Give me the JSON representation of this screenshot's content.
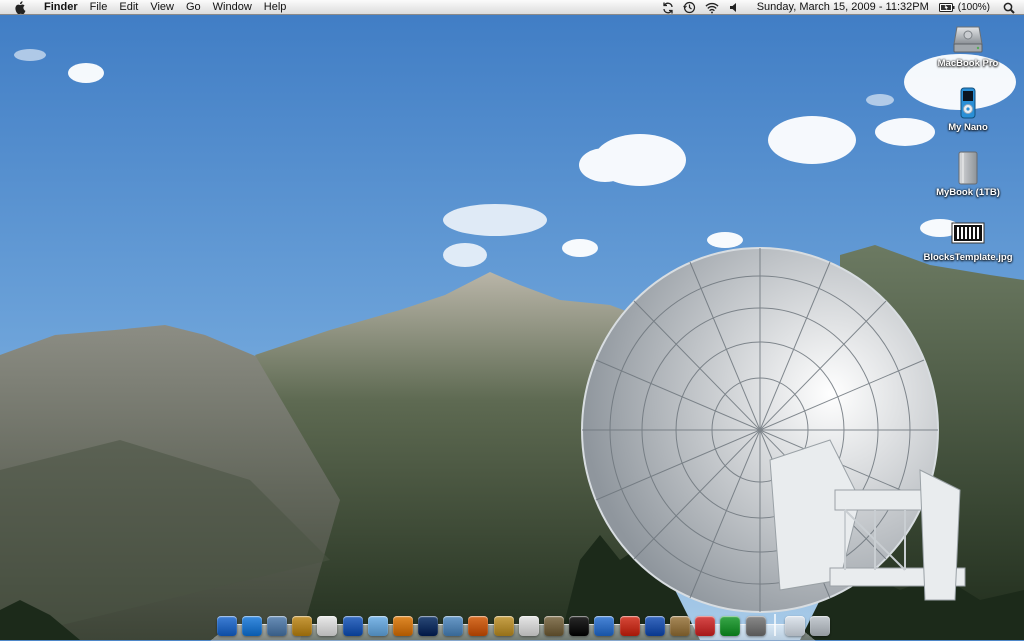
{
  "menubar": {
    "app_name": "Finder",
    "menus": [
      "File",
      "Edit",
      "View",
      "Go",
      "Window",
      "Help"
    ],
    "clock": "Sunday, March 15, 2009 - 11:32PM",
    "battery": "(100%)"
  },
  "desktop_icons": [
    {
      "label": "MacBook Pro",
      "icon": "hard-drive-icon"
    },
    {
      "label": "My Nano",
      "icon": "ipod-nano-icon"
    },
    {
      "label": "MyBook (1TB)",
      "icon": "external-drive-icon"
    },
    {
      "label": "BlocksTemplate.jpg",
      "icon": "image-file-icon"
    }
  ],
  "dock": {
    "apps": [
      {
        "icon": "finder-icon",
        "color": "#3f7fd6"
      },
      {
        "icon": "safari-icon",
        "color": "#3b8de0"
      },
      {
        "icon": "mail-icon",
        "color": "#6a8fb8"
      },
      {
        "icon": "address-book-icon",
        "color": "#c89a3c"
      },
      {
        "icon": "ical-icon",
        "color": "#e9e9e9"
      },
      {
        "icon": "word-icon",
        "color": "#3a6fc4"
      },
      {
        "icon": "itunes-icon",
        "color": "#7fb8e8"
      },
      {
        "icon": "growl-icon",
        "color": "#e08a2a"
      },
      {
        "icon": "quicktime-icon",
        "color": "#2b4a78"
      },
      {
        "icon": "iphoto-icon",
        "color": "#6a9ac8"
      },
      {
        "icon": "garageband-icon",
        "color": "#d8702a"
      },
      {
        "icon": "preview-icon",
        "color": "#c8a24a"
      },
      {
        "icon": "textedit-icon",
        "color": "#e6e6e6"
      },
      {
        "icon": "font-book-icon",
        "color": "#8a7a5a"
      },
      {
        "icon": "terminal-icon",
        "color": "#2a2a2a"
      },
      {
        "icon": "app-store-icon",
        "color": "#4a86d8"
      },
      {
        "icon": "grapher-icon",
        "color": "#d84a3a"
      },
      {
        "icon": "spaces-icon",
        "color": "#3a6ac0"
      },
      {
        "icon": "gimp-icon",
        "color": "#a88a5a"
      },
      {
        "icon": "calendar-grid-icon",
        "color": "#d84a4a"
      },
      {
        "icon": "feed-icon",
        "color": "#3aa84a"
      },
      {
        "icon": "system-preferences-icon",
        "color": "#8a8a8a"
      }
    ],
    "trailing": [
      {
        "icon": "documents-stack-icon",
        "color": "#dfe6ee"
      },
      {
        "icon": "trash-icon",
        "color": "#c6ccd2"
      }
    ]
  }
}
